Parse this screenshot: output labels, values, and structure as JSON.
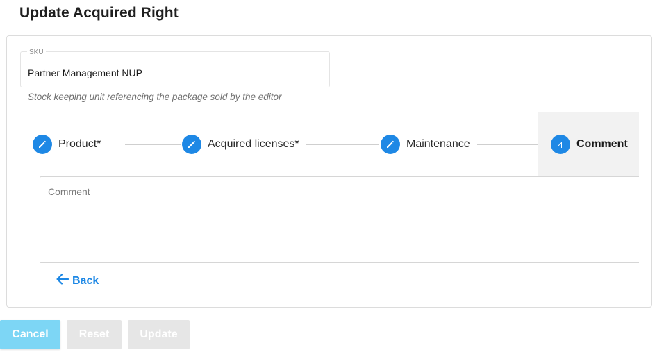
{
  "page": {
    "title": "Update Acquired Right"
  },
  "sku": {
    "label": "SKU",
    "value": "Partner Management NUP",
    "hint": "Stock keeping unit referencing the package sold by the editor"
  },
  "stepper": {
    "steps": [
      {
        "label": "Product*",
        "icon": "pencil-icon",
        "state": "edit"
      },
      {
        "label": "Acquired licenses*",
        "icon": "pencil-icon",
        "state": "edit"
      },
      {
        "label": "Maintenance",
        "icon": "pencil-icon",
        "state": "edit"
      },
      {
        "label": "Comment",
        "number": "4",
        "state": "active"
      }
    ]
  },
  "comment": {
    "placeholder": "Comment",
    "value": ""
  },
  "back": {
    "label": "Back",
    "icon": "arrow-left-icon"
  },
  "buttons": {
    "cancel": "Cancel",
    "reset": "Reset",
    "update": "Update"
  },
  "colors": {
    "accent": "#1e88e5",
    "cancel_button": "#7dd6f5",
    "disabled_button": "#e6e6e6",
    "active_step_bg": "#f2f2f2"
  }
}
